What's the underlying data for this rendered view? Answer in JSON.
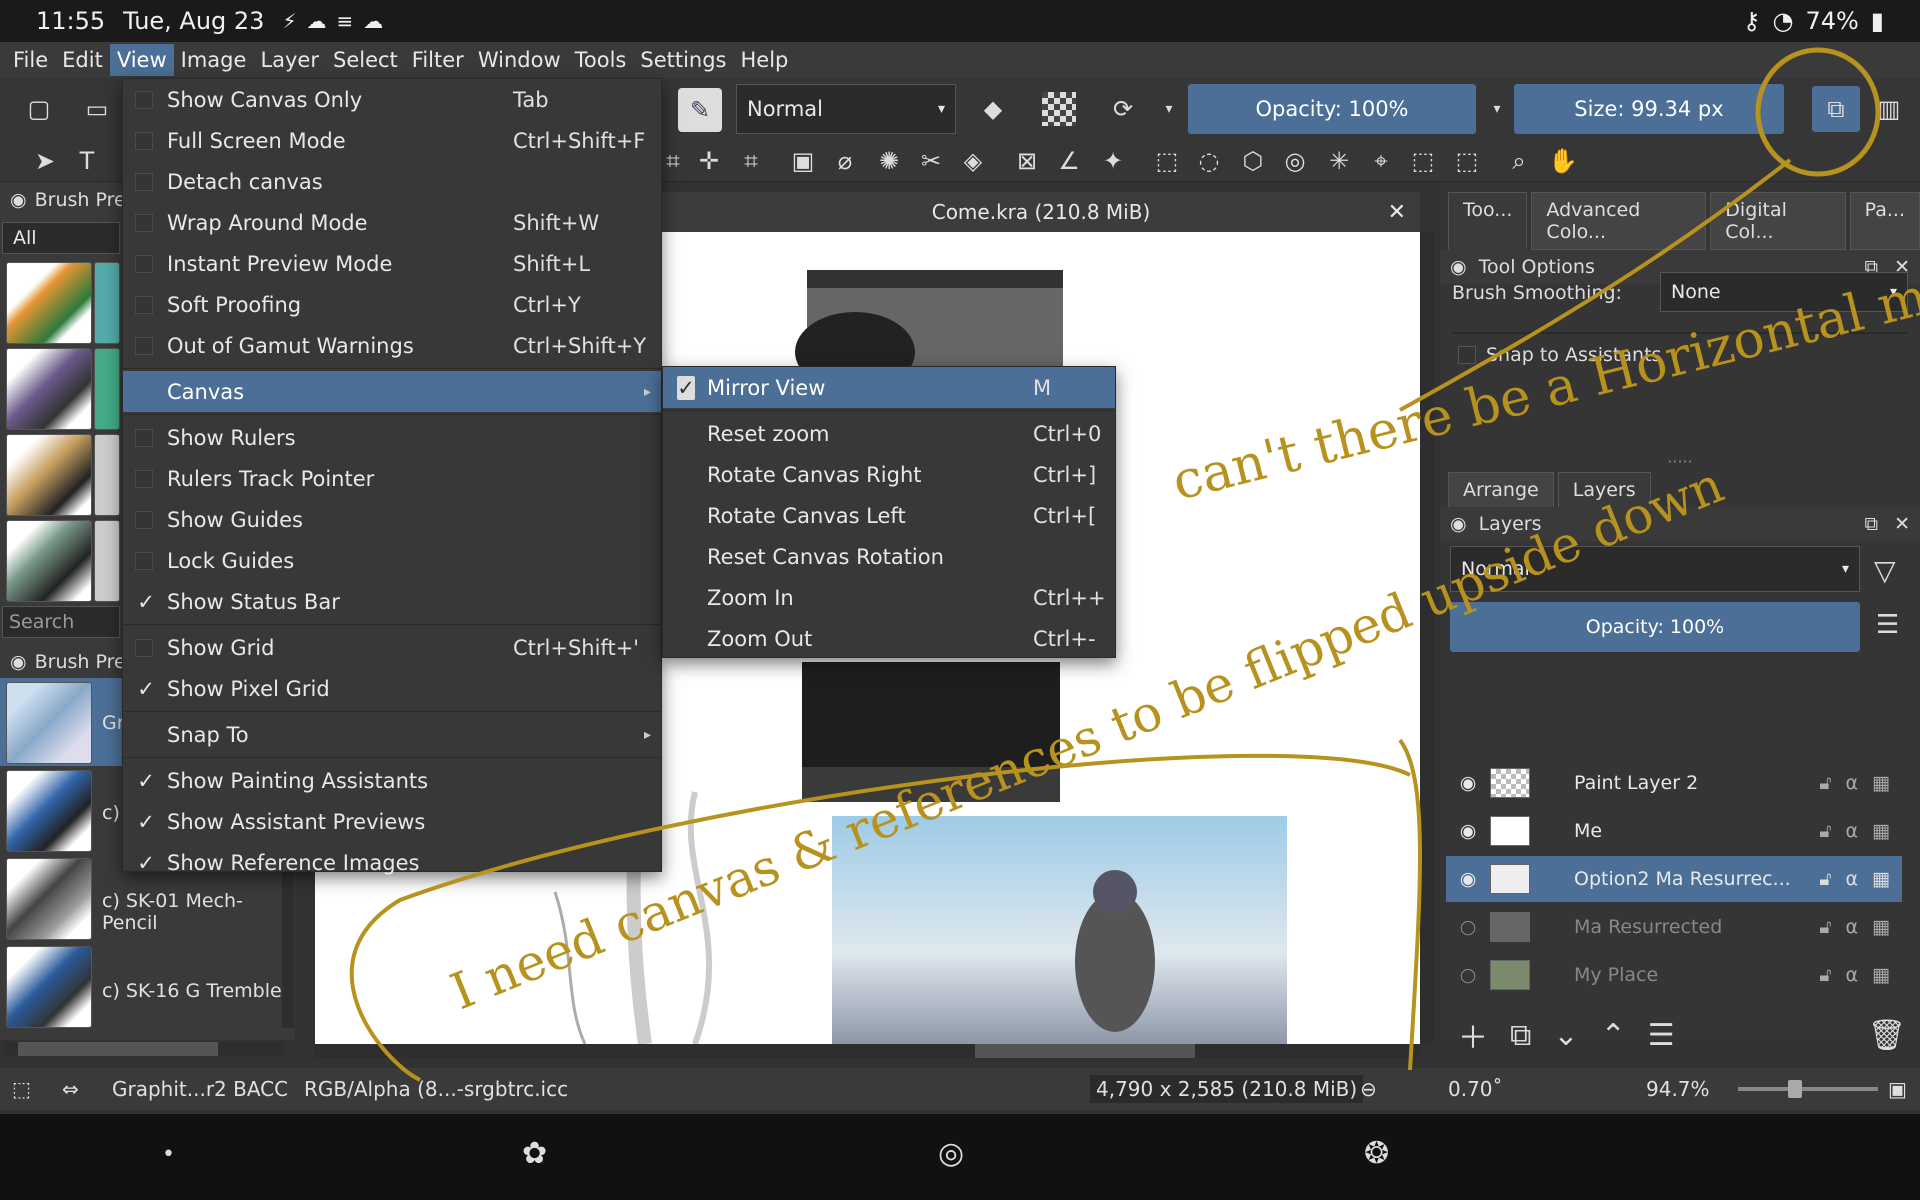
{
  "system_status": {
    "time": "11:55",
    "date": "Tue, Aug 23",
    "battery": "74%"
  },
  "menubar": [
    "File",
    "Edit",
    "View",
    "Image",
    "Layer",
    "Select",
    "Filter",
    "Window",
    "Tools",
    "Settings",
    "Help"
  ],
  "toolbar": {
    "blend_mode": "Normal",
    "opacity": "Opacity: 100%",
    "size": "Size: 99.34 px"
  },
  "document": {
    "tab_title": "Come.kra (210.8 MiB)"
  },
  "left_docker": {
    "brush_presets_title": "Brush Pre",
    "filter_all": "All",
    "search_placeholder": "Search",
    "brush_presets_title2": "Brush Pre",
    "brushes": [
      "Gr",
      "c)",
      "c) SK-01 Mech-Pencil",
      "c) SK-16 G Tremble"
    ]
  },
  "view_menu": {
    "items": [
      {
        "label": "Show Canvas Only",
        "shortcut": "Tab",
        "checked": false
      },
      {
        "label": "Full Screen Mode",
        "shortcut": "Ctrl+Shift+F",
        "checked": false
      },
      {
        "label": "Detach canvas",
        "shortcut": "",
        "checked": false
      },
      {
        "label": "Wrap Around Mode",
        "shortcut": "Shift+W",
        "checked": false
      },
      {
        "label": "Instant Preview Mode",
        "shortcut": "Shift+L",
        "checked": false
      },
      {
        "label": "Soft Proofing",
        "shortcut": "Ctrl+Y",
        "checked": false
      },
      {
        "label": "Out of Gamut Warnings",
        "shortcut": "Ctrl+Shift+Y",
        "checked": false
      },
      {
        "label": "Canvas",
        "shortcut": "",
        "submenu": true
      },
      {
        "label": "Show Rulers",
        "shortcut": "",
        "checked": false
      },
      {
        "label": "Rulers Track Pointer",
        "shortcut": "",
        "checked": false
      },
      {
        "label": "Show Guides",
        "shortcut": "",
        "checked": false
      },
      {
        "label": "Lock Guides",
        "shortcut": "",
        "checked": false
      },
      {
        "label": "Show Status Bar",
        "shortcut": "",
        "checked": true
      },
      {
        "label": "Show Grid",
        "shortcut": "Ctrl+Shift+'",
        "checked": false
      },
      {
        "label": "Show Pixel Grid",
        "shortcut": "",
        "checked": true
      },
      {
        "label": "Snap To",
        "shortcut": "",
        "submenu": true
      },
      {
        "label": "Show Painting Assistants",
        "shortcut": "",
        "checked": true
      },
      {
        "label": "Show Assistant Previews",
        "shortcut": "",
        "checked": true
      },
      {
        "label": "Show Reference Images",
        "shortcut": "",
        "checked": true
      }
    ]
  },
  "canvas_submenu": {
    "items": [
      {
        "label": "Mirror View",
        "shortcut": "M",
        "checked": true
      },
      {
        "label": "Reset zoom",
        "shortcut": "Ctrl+0"
      },
      {
        "label": "Rotate Canvas Right",
        "shortcut": "Ctrl+]"
      },
      {
        "label": "Rotate Canvas Left",
        "shortcut": "Ctrl+["
      },
      {
        "label": "Reset Canvas Rotation",
        "shortcut": ""
      },
      {
        "label": "Zoom In",
        "shortcut": "Ctrl++"
      },
      {
        "label": "Zoom Out",
        "shortcut": "Ctrl+-"
      }
    ]
  },
  "right_panel": {
    "tabs_top": [
      "Too...",
      "Advanced Colo...",
      "Digital Col...",
      "Pa..."
    ],
    "tool_options_title": "Tool Options",
    "brush_smoothing_label": "Brush Smoothing:",
    "brush_smoothing_value": "None",
    "snap_to_assistants": "Snap to Assistants",
    "tabs_bottom": [
      "Arrange",
      "Layers"
    ],
    "layers_title": "Layers",
    "layers_blend": "Normal",
    "layers_opacity": "Opacity:  100%",
    "layers": [
      {
        "name": "Paint Layer 2",
        "visible": true,
        "selected": false
      },
      {
        "name": "Me",
        "visible": true,
        "selected": false
      },
      {
        "name": "Option2 Ma Resurrec...",
        "visible": true,
        "selected": true
      },
      {
        "name": "Ma Resurrected",
        "visible": false,
        "selected": false
      },
      {
        "name": "My Place",
        "visible": false,
        "selected": false
      }
    ]
  },
  "annotations": {
    "top_note": "can't there be a Horizontal mirror tool too?",
    "bottom_note": "I need canvas & references to be flipped upside down"
  },
  "bottom_status": {
    "brush": "Graphit...r2 BACC",
    "color_space": "RGB/Alpha (8...-srgbtrc.icc",
    "dimensions": "4,790 x 2,585 (210.8 MiB)",
    "rotation": "0.70˚",
    "zoom": "94.7%"
  },
  "accent_color": "#4b6f96",
  "annotation_color": "#b8921e"
}
